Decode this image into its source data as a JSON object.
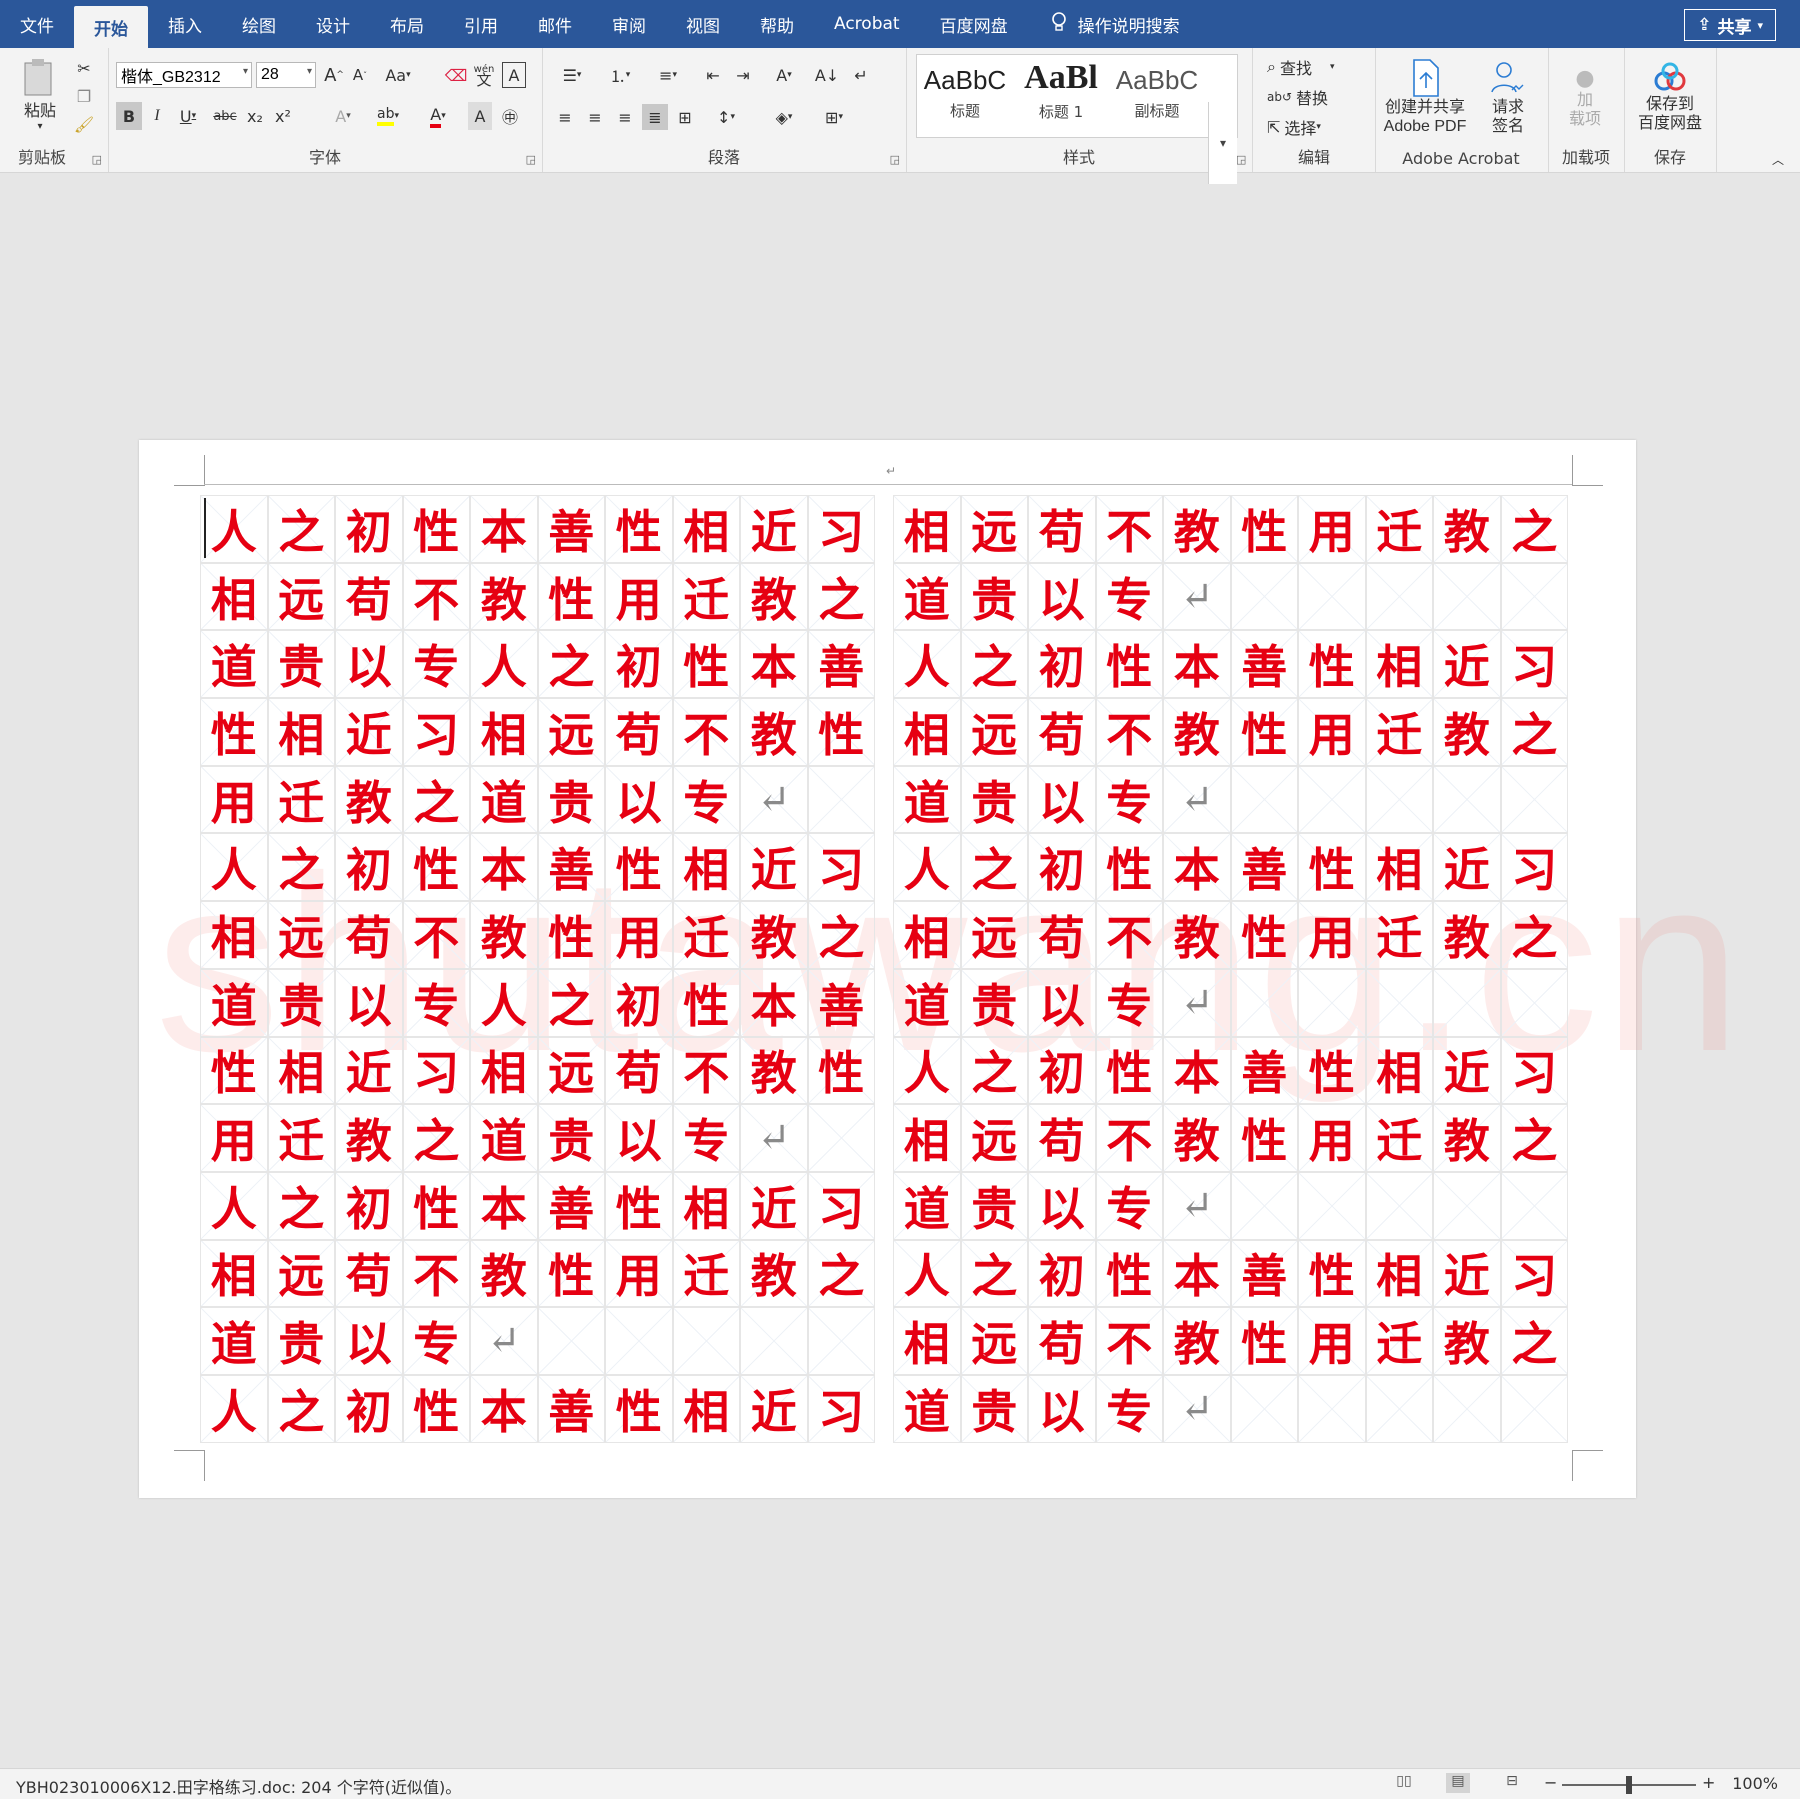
{
  "tabs": [
    "文件",
    "开始",
    "插入",
    "绘图",
    "设计",
    "布局",
    "引用",
    "邮件",
    "审阅",
    "视图",
    "帮助",
    "Acrobat",
    "百度网盘"
  ],
  "active_tab": "开始",
  "tell_me": "操作说明搜索",
  "share": "共享",
  "clipboard": {
    "paste": "粘贴",
    "label": "剪贴板"
  },
  "font": {
    "name": "楷体_GB2312",
    "size": "28",
    "label": "字体",
    "case_btn": "Aa",
    "pinyin": "wén",
    "bold": "B",
    "italic": "I",
    "underline": "U",
    "strike": "abc",
    "sub": "x₂",
    "sup": "x²",
    "color_a": "A"
  },
  "paragraph": {
    "label": "段落"
  },
  "styles": {
    "label": "样式",
    "items": [
      {
        "sample": "AaBbC",
        "name": "标题"
      },
      {
        "sample": "AaBl",
        "name": "标题 1"
      },
      {
        "sample": "AaBbC",
        "name": "副标题"
      }
    ]
  },
  "editing": {
    "find": "查找",
    "replace": "替换",
    "select": "选择",
    "label": "编辑"
  },
  "acrobat": {
    "create": "创建并共享",
    "create2": "Adobe PDF",
    "sign": "请求",
    "sign2": "签名",
    "label": "Adobe Acrobat"
  },
  "addins": {
    "line1": "加",
    "line2": "载项",
    "label": "加载项"
  },
  "save": {
    "line1": "保存到",
    "line2": "百度网盘",
    "label": "保存"
  },
  "doc": {
    "watermark": "shutawang.cn",
    "return_mark": "↵",
    "left_rows": [
      "人之初性本善性相近习",
      "相远苟不教性用迁教之",
      "道贵以专人之初性本善",
      "性相近习相远苟不教性",
      "用迁教之道贵以专↵",
      "人之初性本善性相近习",
      "相远苟不教性用迁教之",
      "道贵以专人之初性本善",
      "性相近习相远苟不教性",
      "用迁教之道贵以专↵",
      "人之初性本善性相近习",
      "相远苟不教性用迁教之",
      "道贵以专↵",
      "人之初性本善性相近习"
    ],
    "right_rows": [
      "相远苟不教性用迁教之",
      "道贵以专↵",
      "人之初性本善性相近习",
      "相远苟不教性用迁教之",
      "道贵以专↵",
      "人之初性本善性相近习",
      "相远苟不教性用迁教之",
      "道贵以专↵",
      "人之初性本善性相近习",
      "相远苟不教性用迁教之",
      "道贵以专↵",
      "人之初性本善性相近习",
      "相远苟不教性用迁教之",
      "道贵以专↵"
    ]
  },
  "status": {
    "left": "YBH023010006X12.田字格练习.doc: 204 个字符(近似值)。",
    "zoom": "100%",
    "zoom_minus": "−",
    "zoom_plus": "+"
  },
  "colors": {
    "accent": "#2b579a",
    "text_red": "#e60012"
  }
}
